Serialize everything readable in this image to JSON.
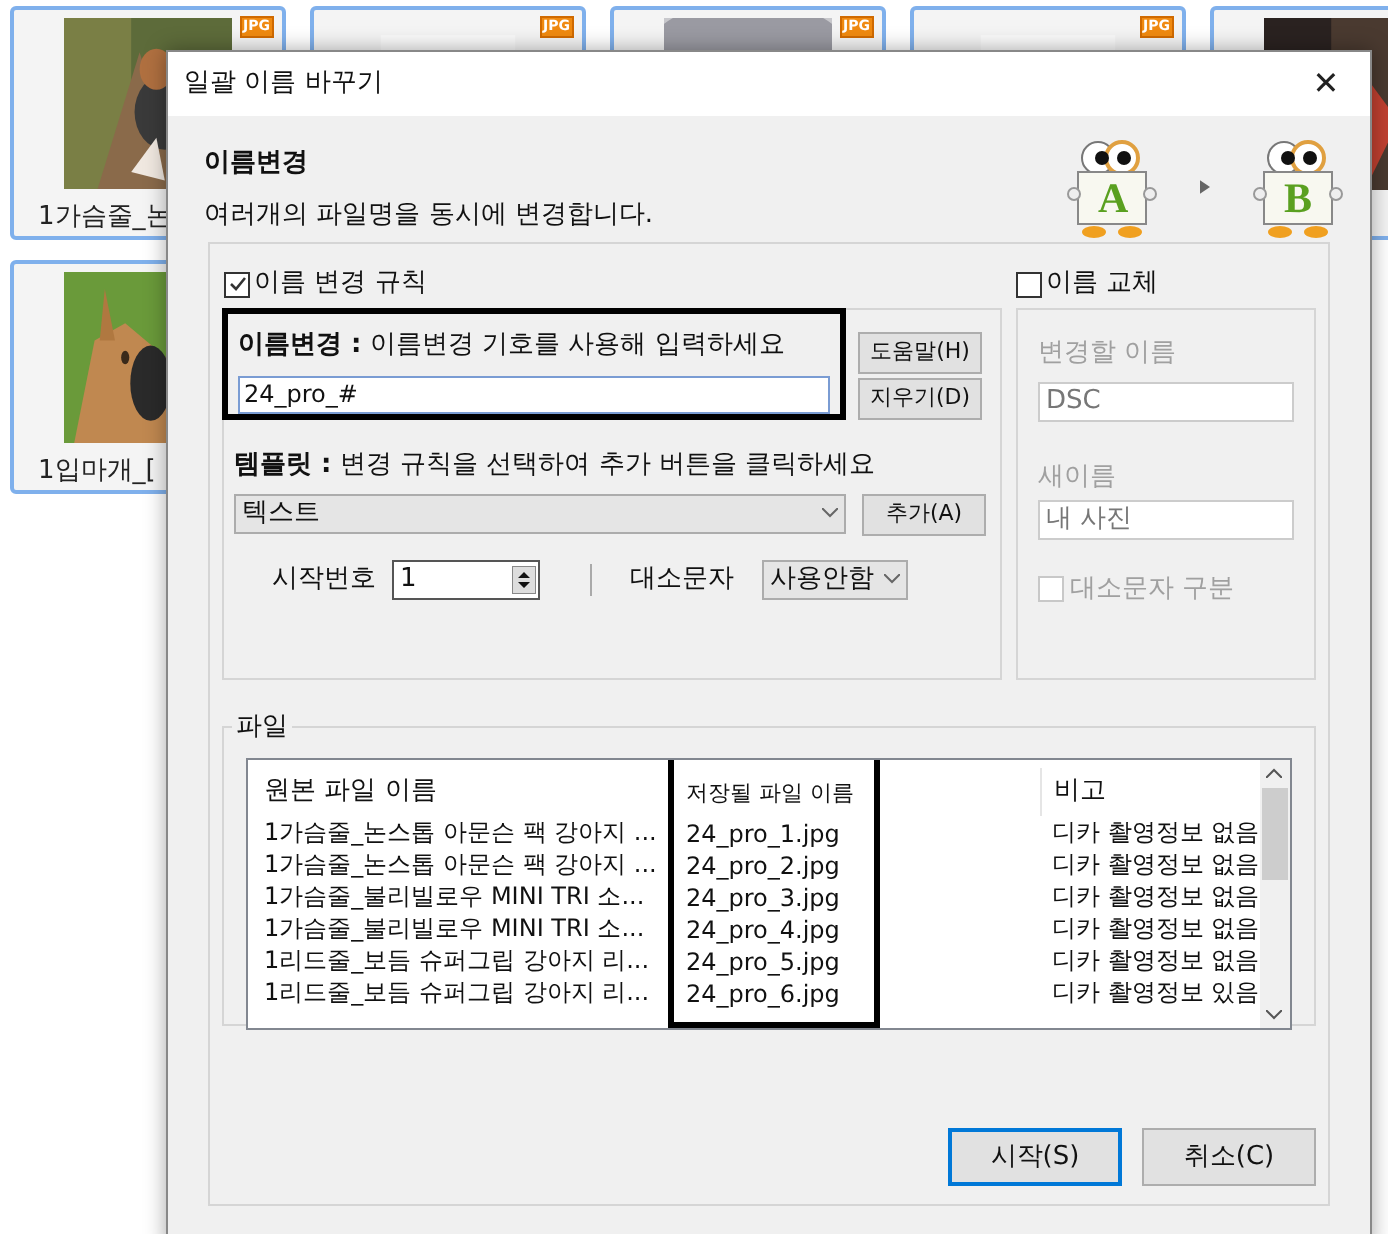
{
  "background_tiles": [
    {
      "caption": "1가슴줄_논",
      "badge": "JPG",
      "kind": "dog"
    },
    {
      "badge": "JPG",
      "kind": "blank"
    },
    {
      "badge": "JPG",
      "kind": "cat"
    },
    {
      "badge": "JPG",
      "kind": "blank"
    },
    {
      "kind": "dark"
    },
    {
      "caption": "1입마개_[",
      "kind": "dog2"
    }
  ],
  "window": {
    "title": "일괄 이름 바꾸기",
    "close": "✕"
  },
  "header": {
    "title": "이름변경",
    "subtitle": "여러개의 파일명을 동시에 변경합니다.",
    "from_letter": "A",
    "to_letter": "B"
  },
  "rename_rule": {
    "label": "이름 변경 규칙",
    "checked": true,
    "pattern_label_bold": "이름변경 :",
    "pattern_label": "이름변경 기호를 사용해 입력하세요",
    "pattern_value": "24_pro_#",
    "help_button": "도움말(H)",
    "clear_button": "지우기(D)",
    "template_label_bold": "템플릿 :",
    "template_label": "변경 규칙을 선택하여 추가 버튼을 클릭하세요",
    "template_value": "텍스트",
    "add_button": "추가(A)",
    "start_number_label": "시작번호",
    "start_number": "1",
    "case_label": "대소문자",
    "case_value": "사용안함"
  },
  "replace": {
    "label": "이름 교체",
    "checked": false,
    "find_label": "변경할 이름",
    "find_value": "DSC",
    "new_label": "새이름",
    "new_value": "내 사진",
    "case_sensitive_label": "대소문자 구분",
    "case_sensitive": false
  },
  "files": {
    "group_label": "파일",
    "columns": [
      "원본 파일 이름",
      "저장될 파일 이름",
      "비고"
    ],
    "rows": [
      [
        "1가슴줄_논스톱 아문슨 팩 강아지 ...",
        "24_pro_1.jpg",
        "디카 촬영정보 없음"
      ],
      [
        "1가슴줄_논스톱 아문슨 팩 강아지 ...",
        "24_pro_2.jpg",
        "디카 촬영정보 없음"
      ],
      [
        "1가슴줄_불리빌로우 MINI TRI 소...",
        "24_pro_3.jpg",
        "디카 촬영정보 없음"
      ],
      [
        "1가슴줄_불리빌로우 MINI TRI 소...",
        "24_pro_4.jpg",
        "디카 촬영정보 없음"
      ],
      [
        "1리드줄_보듬 슈퍼그립 강아지 리...",
        "24_pro_5.jpg",
        "디카 촬영정보 없음"
      ],
      [
        "1리드줄_보듬 슈퍼그립 강아지 리...",
        "24_pro_6.jpg",
        "디카 촬영정보 있음"
      ]
    ]
  },
  "buttons": {
    "start": "시작(S)",
    "cancel": "취소(C)"
  }
}
